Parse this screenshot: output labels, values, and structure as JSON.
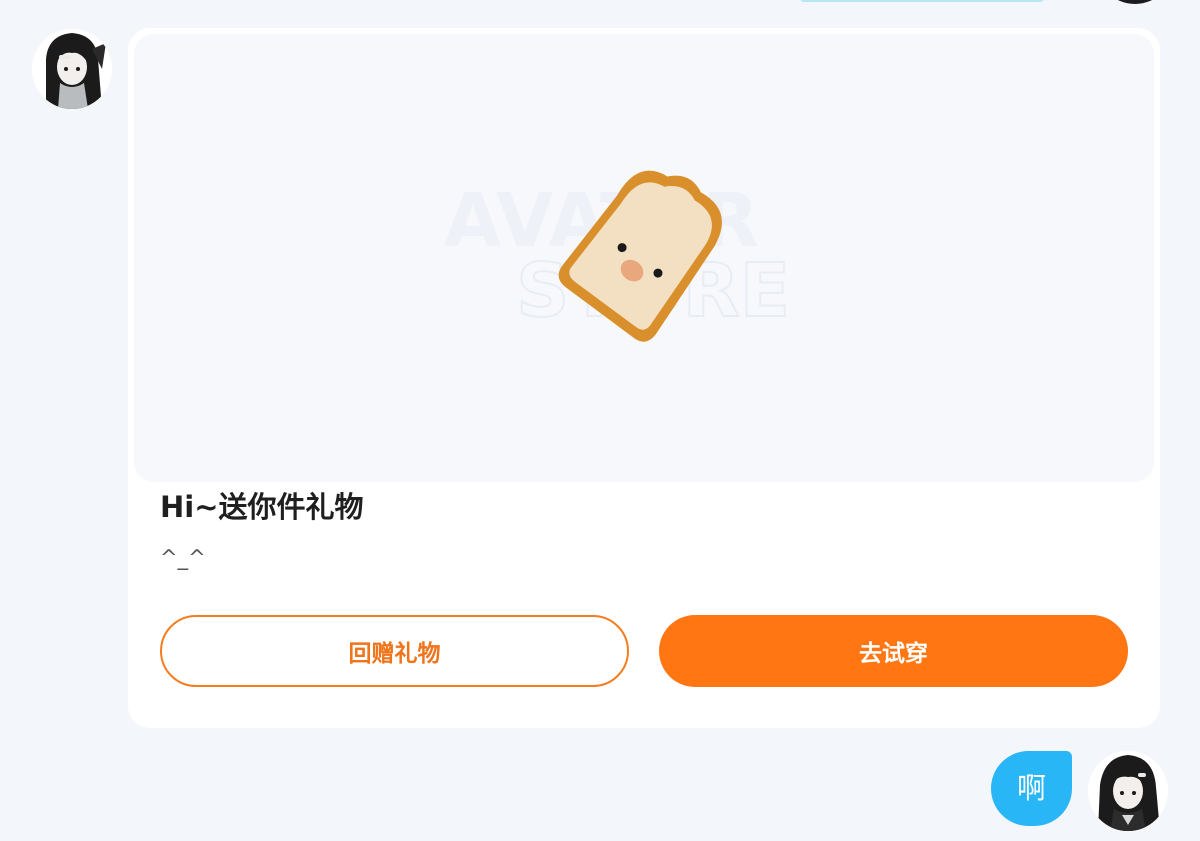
{
  "gift_card": {
    "image_watermark": "AVATAR STORE",
    "title": "Hi~送你件礼物",
    "message": "^_^",
    "return_gift_button": "回赠礼物",
    "try_on_button": "去试穿",
    "gift_item": "toast-character-icon"
  },
  "outgoing_message": {
    "text": "啊"
  },
  "colors": {
    "page_background": "#f3f6fa",
    "card_background": "#ffffff",
    "accent_orange": "#ff7612",
    "bubble_blue": "#29b6f6"
  }
}
